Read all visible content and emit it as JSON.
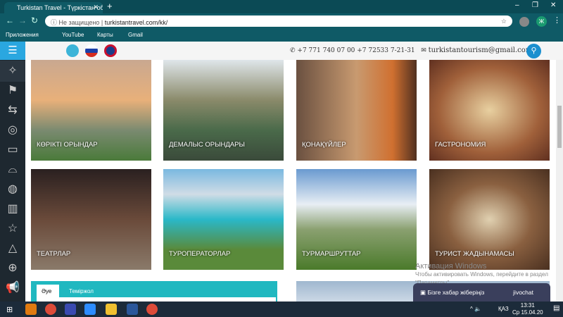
{
  "browser": {
    "tab_title": "Turkistan Travel - Түркістан обл",
    "security": "Не защищено",
    "url": "turkistantravel.com/kk/",
    "bookmarks": [
      "Приложения",
      "YouTube",
      "Карты",
      "Gmail"
    ],
    "profile": "Ж"
  },
  "header": {
    "phones": "+7 771 740 07 00 +7 72533 7-21-31",
    "email": "turkistantourism@gmail.com"
  },
  "categories": [
    {
      "label": "КӨРІКТІ ОРЫНДАР"
    },
    {
      "label": "ДЕМАЛЫС ОРЫНДАРЫ"
    },
    {
      "label": "ҚОНАҚҮЙЛЕР"
    },
    {
      "label": "ГАСТРОНОМИЯ"
    },
    {
      "label": "ТЕАТРЛАР"
    },
    {
      "label": "ТУРОПЕРАТОРЛАР"
    },
    {
      "label": "ТУРМАРШРУТТАР"
    },
    {
      "label": "ТУРИСТ ЖАДЫНАМАСЫ"
    }
  ],
  "widget": {
    "tabs": [
      "Әуе",
      "Теміржол"
    ]
  },
  "chat": {
    "label": "Бізге хабар жіберіңіз",
    "brand": "jivochat"
  },
  "watermark": {
    "line1": "Активация Windows",
    "line2": "Чтобы активировать Windows, перейдите в раздел \"Параметры\"."
  },
  "taskbar": {
    "lang": "ҚАЗ",
    "time": "13:31",
    "date": "Ср 15.04.20"
  }
}
